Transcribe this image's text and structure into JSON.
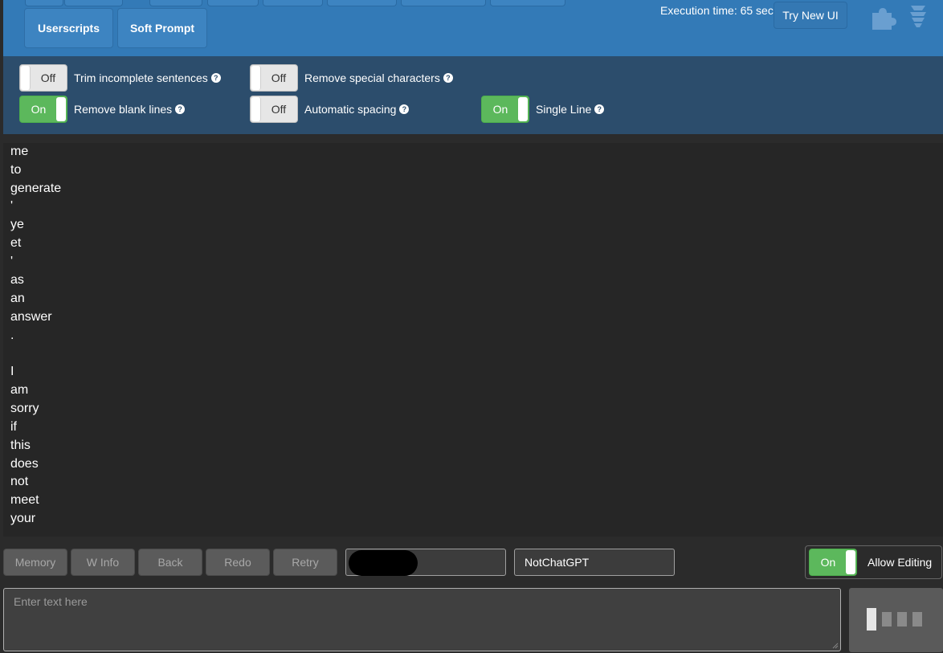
{
  "header": {
    "nav_buttons": [
      "Userscripts",
      "Soft Prompt"
    ],
    "execution_time": "Execution time: 65 sec",
    "try_new_ui": "Try New UI",
    "icons": [
      "puzzle-icon",
      "lightbulb-icon"
    ]
  },
  "settings": {
    "trim_incomplete": {
      "state": "Off",
      "label": "Trim incomplete sentences",
      "help": "?"
    },
    "remove_special": {
      "state": "Off",
      "label": "Remove special characters",
      "help": "?"
    },
    "remove_blank": {
      "state": "On",
      "label": "Remove blank lines",
      "help": "?"
    },
    "auto_spacing": {
      "state": "Off",
      "label": "Automatic spacing",
      "help": "?"
    },
    "single_line": {
      "state": "On",
      "label": "Single Line",
      "help": "?"
    }
  },
  "story": {
    "lines": [
      "me",
      "to",
      "generate",
      "'",
      "ye",
      "et",
      "'",
      "as",
      "an",
      "answer",
      ".",
      "",
      "I",
      "am",
      "sorry",
      "if",
      "this",
      "does",
      "not",
      "meet",
      "your"
    ]
  },
  "actions": {
    "memory": "Memory",
    "w_info": "W Info",
    "back": "Back",
    "redo": "Redo",
    "retry": "Retry"
  },
  "fields": {
    "user_name": "",
    "bot_name": "NotChatGPT"
  },
  "allow_editing": {
    "state": "On",
    "label": "Allow Editing"
  },
  "input": {
    "placeholder": "Enter text here"
  },
  "colors": {
    "header": "#337ab7",
    "settings": "#2c4d6c",
    "toggle_on": "#5cb85c",
    "story_bg": "#262626"
  }
}
